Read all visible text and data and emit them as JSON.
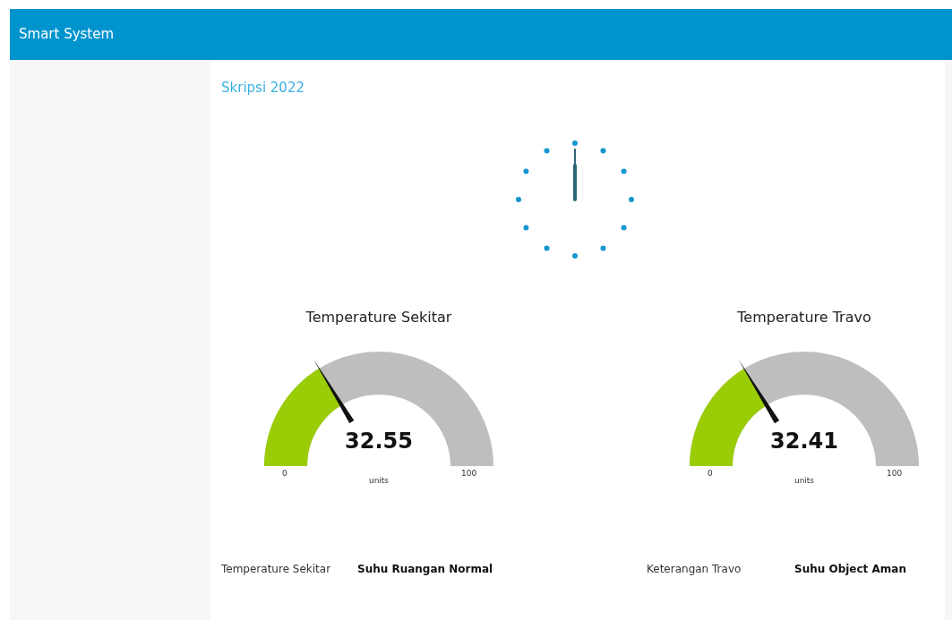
{
  "header": {
    "title": "Smart System"
  },
  "group": {
    "title": "Skripsi 2022"
  },
  "gauges": [
    {
      "title": "Temperature Sekitar",
      "value": "32.55",
      "units": "units",
      "min": "0",
      "max": "100",
      "level": 0.3255
    },
    {
      "title": "Temperature Travo",
      "value": "32.41",
      "units": "units",
      "min": "0",
      "max": "100",
      "level": 0.3241
    }
  ],
  "status": [
    {
      "label": "Temperature Sekitar",
      "value": "Suhu Ruangan Normal"
    },
    {
      "label": "Keterangan Travo",
      "value": "Suhu Object Aman"
    }
  ]
}
